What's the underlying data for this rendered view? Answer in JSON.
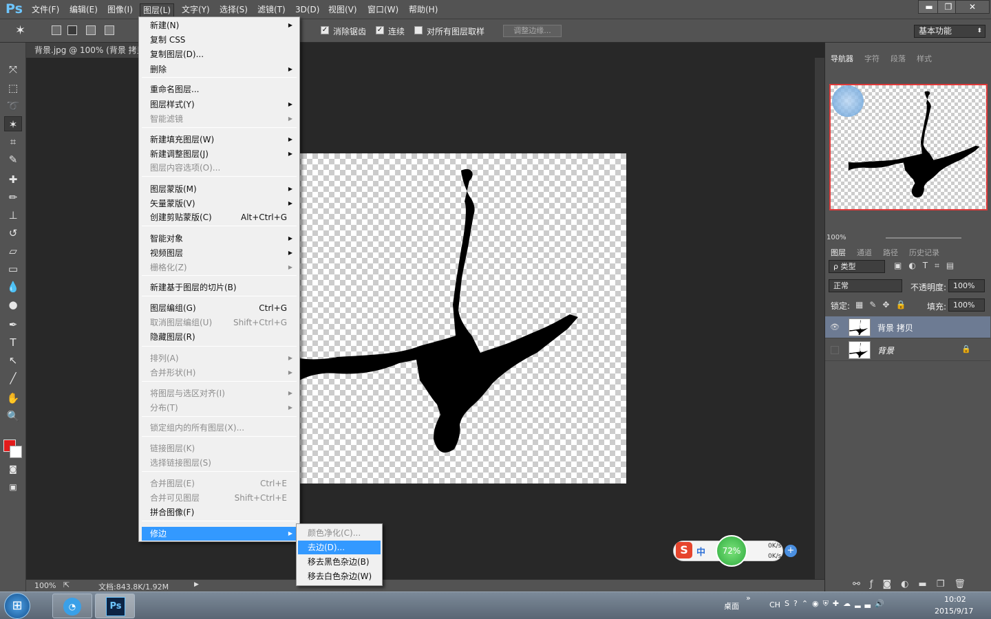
{
  "app": {
    "logo": "Ps"
  },
  "menubar": {
    "items": [
      "文件(F)",
      "编辑(E)",
      "图像(I)",
      "图层(L)",
      "文字(Y)",
      "选择(S)",
      "滤镜(T)",
      "3D(D)",
      "视图(V)",
      "窗口(W)",
      "帮助(H)"
    ],
    "active": "图层(L)"
  },
  "window_controls": {
    "minimize": "▬",
    "restore": "❐",
    "close": "✕"
  },
  "options": {
    "antialias": "消除锯齿",
    "contiguous": "连续",
    "sample_all": "对所有图层取样",
    "refine_edge": "调整边缘...",
    "workspace": "基本功能"
  },
  "document": {
    "tab_title": "背景.jpg @ 100% (背景 拷贝",
    "zoom": "100%",
    "doc_info": "文档:843.8K/1.92M"
  },
  "layer_menu": {
    "items": [
      {
        "label": "新建(N)",
        "submenu": true
      },
      {
        "label": "复制 CSS"
      },
      {
        "label": "复制图层(D)..."
      },
      {
        "label": "删除",
        "submenu": true
      },
      {
        "label": "重命名图层..."
      },
      {
        "label": "图层样式(Y)",
        "submenu": true
      },
      {
        "label": "智能滤镜",
        "submenu": true,
        "disabled": true
      },
      {
        "label": "新建填充图层(W)",
        "submenu": true
      },
      {
        "label": "新建调整图层(J)",
        "submenu": true
      },
      {
        "label": "图层内容选项(O)...",
        "disabled": true
      },
      {
        "label": "图层蒙版(M)",
        "submenu": true
      },
      {
        "label": "矢量蒙版(V)",
        "submenu": true
      },
      {
        "label": "创建剪贴蒙版(C)",
        "shortcut": "Alt+Ctrl+G"
      },
      {
        "label": "智能对象",
        "submenu": true
      },
      {
        "label": "视频图层",
        "submenu": true
      },
      {
        "label": "栅格化(Z)",
        "submenu": true,
        "disabled": true
      },
      {
        "label": "新建基于图层的切片(B)"
      },
      {
        "label": "图层编组(G)",
        "shortcut": "Ctrl+G"
      },
      {
        "label": "取消图层编组(U)",
        "shortcut": "Shift+Ctrl+G",
        "disabled": true
      },
      {
        "label": "隐藏图层(R)"
      },
      {
        "label": "排列(A)",
        "submenu": true,
        "disabled": true
      },
      {
        "label": "合并形状(H)",
        "submenu": true,
        "disabled": true
      },
      {
        "label": "将图层与选区对齐(I)",
        "submenu": true,
        "disabled": true
      },
      {
        "label": "分布(T)",
        "submenu": true,
        "disabled": true
      },
      {
        "label": "锁定组内的所有图层(X)...",
        "disabled": true
      },
      {
        "label": "链接图层(K)",
        "disabled": true
      },
      {
        "label": "选择链接图层(S)",
        "disabled": true
      },
      {
        "label": "合并图层(E)",
        "shortcut": "Ctrl+E",
        "disabled": true
      },
      {
        "label": "合并可见图层",
        "shortcut": "Shift+Ctrl+E",
        "disabled": true
      },
      {
        "label": "拼合图像(F)"
      },
      {
        "label": "修边",
        "submenu": true,
        "highlighted": true
      }
    ]
  },
  "matting_submenu": {
    "items": [
      {
        "label": "颜色净化(C)...",
        "disabled": true
      },
      {
        "label": "去边(D)...",
        "highlighted": true
      },
      {
        "label": "移去黑色杂边(B)"
      },
      {
        "label": "移去白色杂边(W)"
      }
    ]
  },
  "navigator": {
    "tabs": [
      "导航器",
      "字符",
      "段落",
      "样式"
    ],
    "zoom": "100%"
  },
  "layers_panel": {
    "tabs": [
      "图层",
      "通道",
      "路径",
      "历史记录"
    ],
    "filter": "ρ 类型",
    "blend_mode": "正常",
    "opacity_label": "不透明度:",
    "opacity": "100%",
    "lock_label": "锁定:",
    "fill_label": "填充:",
    "fill": "100%",
    "layers": [
      {
        "name": "背景 拷贝",
        "visible": true,
        "selected": true
      },
      {
        "name": "背景",
        "visible": false,
        "locked": true
      }
    ]
  },
  "float_widget": {
    "ime": "中",
    "percent": "72%",
    "up": "0K/s",
    "down": "0K/s"
  },
  "taskbar": {
    "desktop": "桌面",
    "lang": "CH",
    "time": "10:02",
    "date": "2015/9/17"
  },
  "colors": {
    "foreground": "#e21b1b",
    "background": "#ffffff",
    "highlight": "#3399ff"
  }
}
